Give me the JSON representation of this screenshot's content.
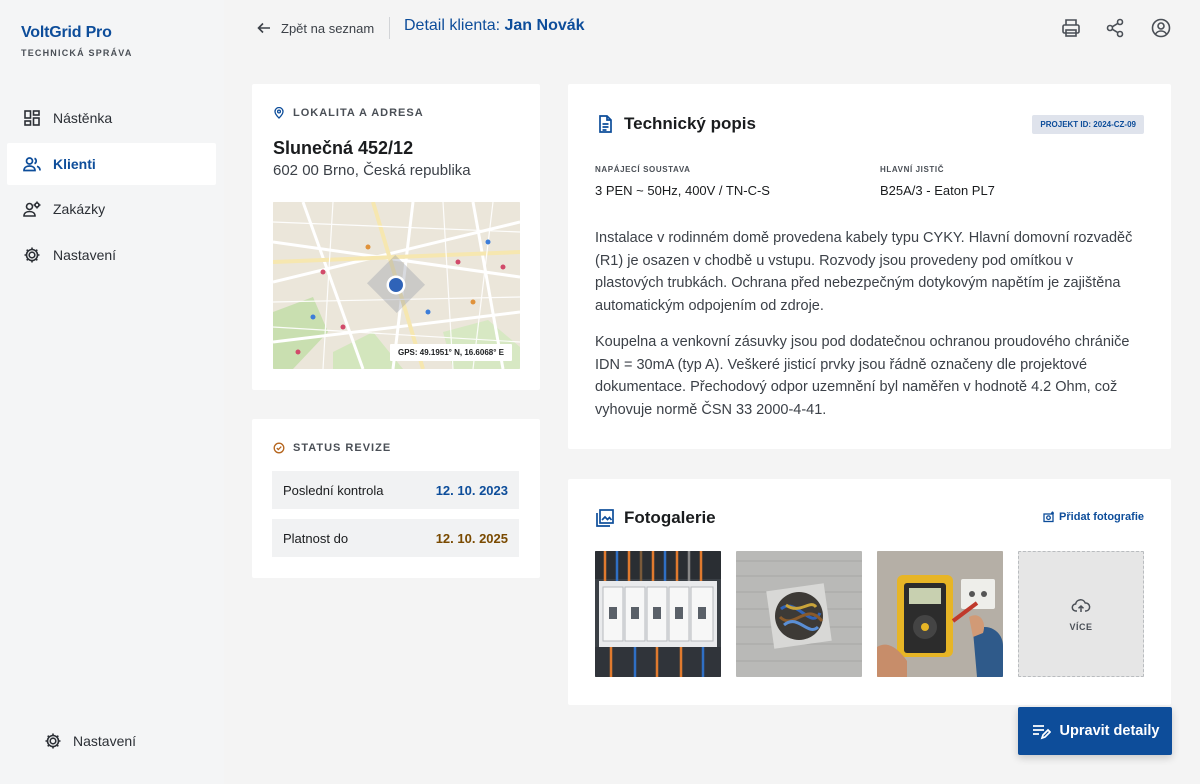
{
  "app": {
    "name": "VoltGrid Pro",
    "subtitle": "TECHNICKÁ SPRÁVA"
  },
  "sidebar": {
    "items": [
      {
        "label": "Nástěnka",
        "icon": "dashboard-icon",
        "active": false
      },
      {
        "label": "Klienti",
        "icon": "people-icon",
        "active": true
      },
      {
        "label": "Zakázky",
        "icon": "engineering-icon",
        "active": false
      },
      {
        "label": "Nastavení",
        "icon": "gear-icon",
        "active": false
      }
    ],
    "bottom_label": "Nastavení"
  },
  "header": {
    "back_label": "Zpět na seznam",
    "title_prefix": "Detail klienta:",
    "title_name": "Jan Novák",
    "icons": [
      "print-icon",
      "share-icon",
      "account-icon"
    ]
  },
  "location": {
    "heading": "LOKALITA A ADRESA",
    "street": "Slunečná 452/12",
    "city": "602 00 Brno, Česká republika",
    "gps": "GPS: 49.1951° N, 16.6068° E"
  },
  "status": {
    "heading": "STATUS REVIZE",
    "rows": [
      {
        "label": "Poslední kontrola",
        "value": "12. 10. 2023",
        "color": "#0d4d9a"
      },
      {
        "label": "Platnost do",
        "value": "12. 10. 2025",
        "color": "#7a4a00"
      }
    ]
  },
  "technical": {
    "title": "Technický popis",
    "project_badge": "PROJEKT ID: 2024-CZ-09",
    "specs": [
      {
        "label": "NAPÁJECÍ SOUSTAVA",
        "value": "3 PEN ~ 50Hz, 400V / TN-C-S"
      },
      {
        "label": "HLAVNÍ JISTIČ",
        "value": "B25A/3 - Eaton PL7"
      }
    ],
    "paragraphs": [
      "Instalace v rodinném domě provedena kabely typu CYKY. Hlavní domovní rozvaděč (R1) je osazen v chodbě u vstupu. Rozvody jsou provedeny pod omítkou v plastových trubkách. Ochrana před nebezpečným dotykovým napětím je zajištěna automatickým odpojením od zdroje.",
      "Koupelna a venkovní zásuvky jsou pod dodatečnou ochranou proudového chrániče IDN = 30mA (typ A). Veškeré jisticí prvky jsou řádně označeny dle projektové dokumentace. Přechodový odpor uzemnění byl naměřen v hodnotě 4.2 Ohm, což vyhovuje normě ČSN 33 2000-4-41."
    ]
  },
  "gallery": {
    "title": "Fotogalerie",
    "add_label": "Přidat fotografie",
    "more_label": "VÍCE"
  },
  "fab": {
    "label": "Upravit detaily"
  },
  "colors": {
    "primary": "#0d4d9a",
    "background": "#f4f4f4",
    "card": "#ffffff"
  }
}
